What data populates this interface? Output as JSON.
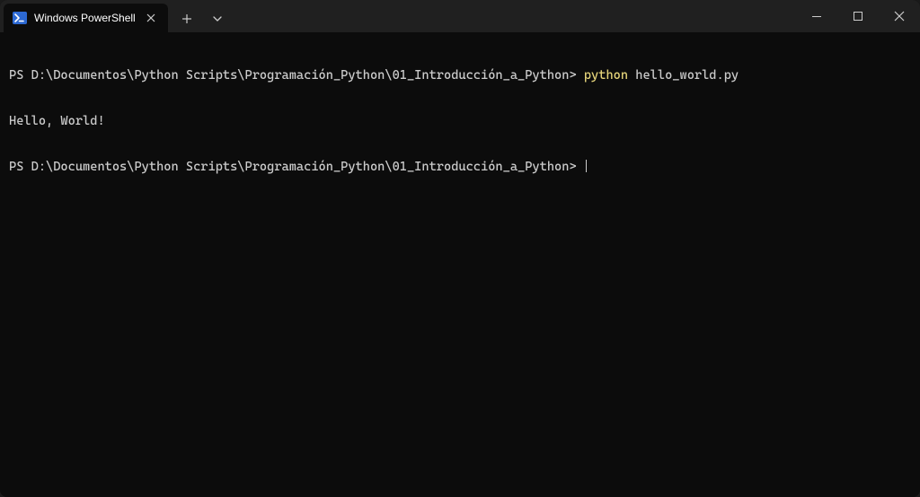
{
  "titlebar": {
    "tab_title": "Windows PowerShell",
    "new_tab_tooltip": "+",
    "dropdown_tooltip": "⌄"
  },
  "window_controls": {
    "minimize": "Minimize",
    "maximize": "Maximize",
    "close": "Close"
  },
  "terminal": {
    "lines": [
      {
        "prompt": "PS D:\\Documentos\\Python Scripts\\Programación_Python\\01_Introducción_a_Python>",
        "command_bin": "python",
        "command_arg": "hello_world.py"
      },
      {
        "output": "Hello, World!"
      },
      {
        "prompt": "PS D:\\Documentos\\Python Scripts\\Programación_Python\\01_Introducción_a_Python>",
        "cursor": true
      }
    ]
  },
  "colors": {
    "background": "#0c0c0c",
    "titlebar": "#202020",
    "text": "#cccccc",
    "command_highlight": "#e5d47a"
  }
}
